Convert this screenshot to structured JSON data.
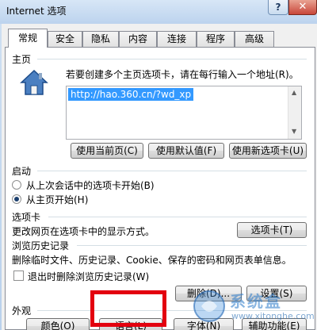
{
  "window": {
    "title": "Internet 选项",
    "help": "?",
    "close": "✕"
  },
  "tabs": [
    "常规",
    "安全",
    "隐私",
    "内容",
    "连接",
    "程序",
    "高级"
  ],
  "homepage": {
    "section": "主页",
    "instruction": "若要创建多个主页选项卡，请在每行输入一个地址(R)。",
    "url": "http://hao.360.cn/?wd_xp",
    "buttons": {
      "use_current": "使用当前页(C)",
      "use_default": "使用默认值(F)",
      "use_new_tab": "使用新选项卡(U)"
    }
  },
  "startup": {
    "section": "启动",
    "options": [
      {
        "label": "从上次会话中的选项卡开始(B)",
        "checked": false
      },
      {
        "label": "从主页开始(H)",
        "checked": true
      }
    ]
  },
  "tabs_section": {
    "section": "选项卡",
    "description": "更改网页在选项卡中的显示方式。",
    "button": "选项卡(T)"
  },
  "history": {
    "section": "浏览历史记录",
    "description": "删除临时文件、历史记录、Cookie、保存的密码和网页表单信息。",
    "checkbox": "退出时删除浏览历史记录(W)",
    "delete_button": "删除(D)...",
    "settings_button": "设置(S)"
  },
  "appearance": {
    "section": "外观",
    "buttons": {
      "colors": "颜色(O)",
      "languages": "语言(L)",
      "fonts": "字体(N)",
      "accessibility": "辅助功能(E)"
    }
  },
  "watermark": {
    "brand": "系统盒",
    "url": "www.xitonghe.com"
  },
  "colors": {
    "highlight": "#e3000f",
    "selection": "#3399ff"
  }
}
